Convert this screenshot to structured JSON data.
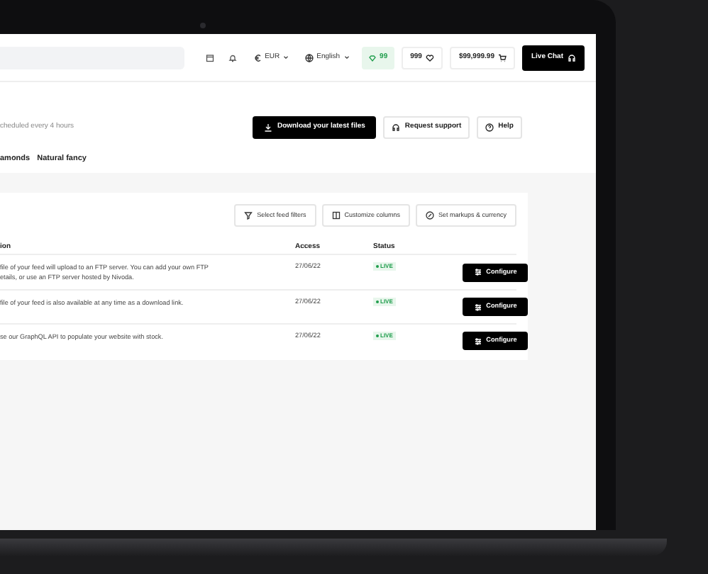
{
  "header": {
    "currency": "EUR",
    "language": "English",
    "badge": "99",
    "favorites": "999",
    "cart_total": "$99,999.99",
    "live_chat": "Live Chat"
  },
  "schedule_text": "cheduled every 4 hours",
  "actions": [
    {
      "kind": "download",
      "label": "Download your latest files",
      "primary": true
    },
    {
      "kind": "support",
      "label": "Request support",
      "primary": false
    },
    {
      "kind": "help",
      "label": "Help",
      "primary": false
    }
  ],
  "tabs": [
    {
      "label": "amonds"
    },
    {
      "label": "Natural fancy"
    }
  ],
  "toolbar": [
    {
      "kind": "filter",
      "label": "Select feed filters"
    },
    {
      "kind": "columns",
      "label": "Customize columns"
    },
    {
      "kind": "markup",
      "label": "Set markups & currency"
    }
  ],
  "table": {
    "columns": [
      "ion",
      "Access",
      "Status"
    ],
    "rows": [
      {
        "description": "file of your feed will upload to an FTP server. You can add your own FTP etails, or use an FTP server hosted by Nivoda.",
        "access": "27/06/22",
        "status": "LIVE",
        "action": "Configure"
      },
      {
        "description": "file of your feed is also available at any time as a download link.",
        "access": "27/06/22",
        "status": "LIVE",
        "action": "Configure"
      },
      {
        "description": "se our GraphQL API to populate your website with stock.",
        "access": "27/06/22",
        "status": "LIVE",
        "action": "Configure"
      }
    ]
  }
}
